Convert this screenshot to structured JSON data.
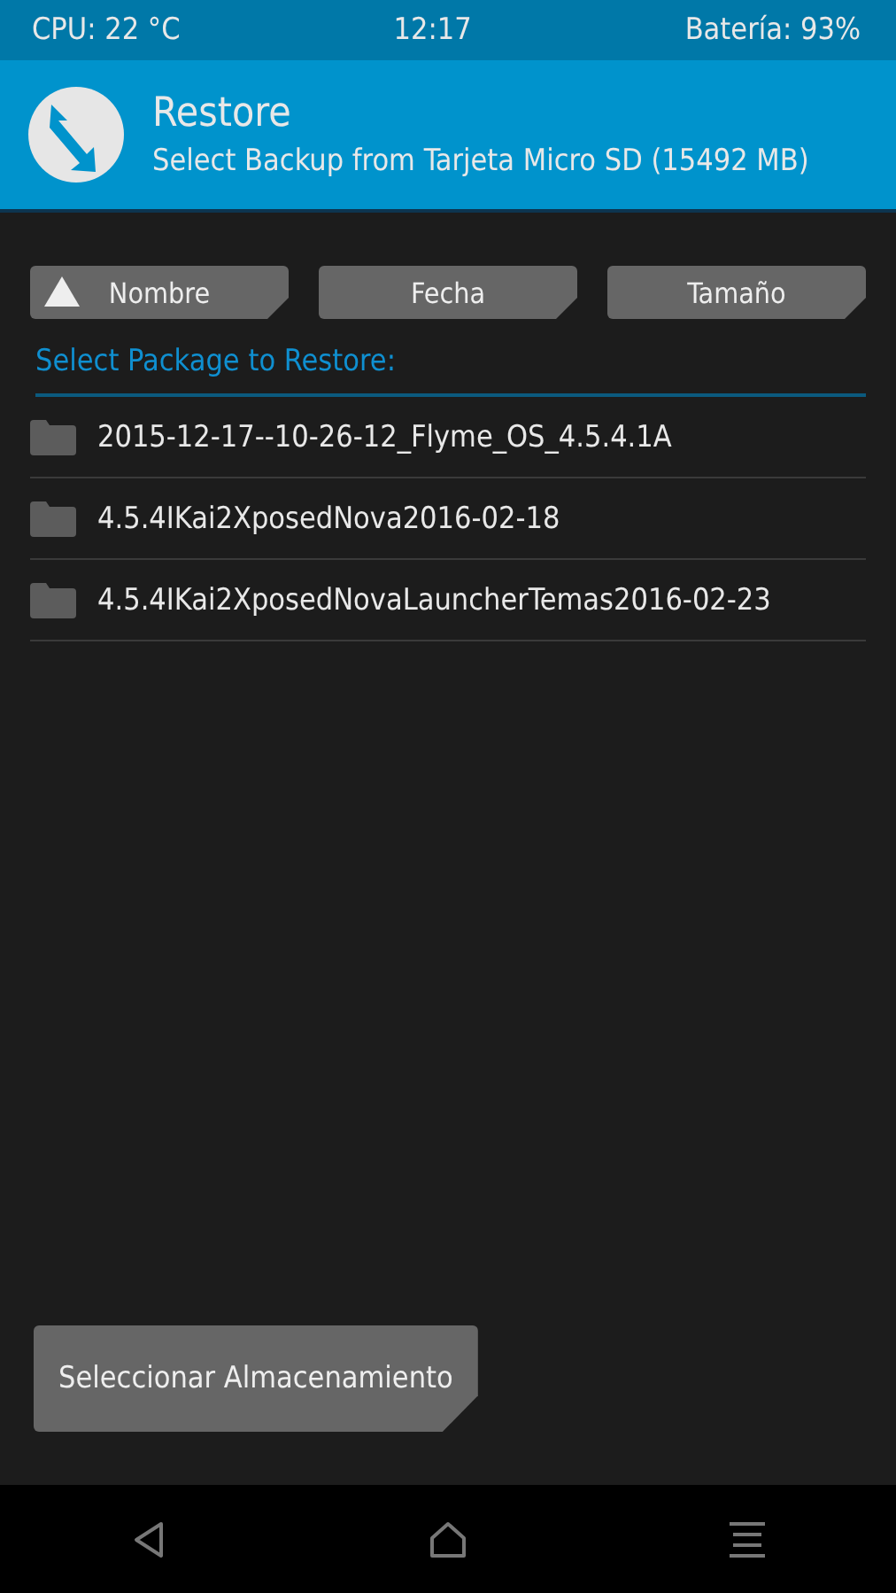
{
  "status_bar": {
    "cpu": "CPU: 22 °C",
    "time": "12:17",
    "battery": "Batería: 93%"
  },
  "header": {
    "title": "Restore",
    "subtitle": "Select Backup from Tarjeta Micro SD (15492 MB)"
  },
  "sort_buttons": [
    {
      "label": "Nombre",
      "selected": true
    },
    {
      "label": "Fecha",
      "selected": false
    },
    {
      "label": "Tamaño",
      "selected": false
    }
  ],
  "list_title": "Select Package to Restore:",
  "packages": [
    {
      "name": "2015-12-17--10-26-12_Flyme_OS_4.5.4.1A"
    },
    {
      "name": "4.5.4IKai2XposedNova2016-02-18"
    },
    {
      "name": "4.5.4IKai2XposedNovaLauncherTemas2016-02-23"
    }
  ],
  "storage_button": "Seleccionar Almacenamiento"
}
